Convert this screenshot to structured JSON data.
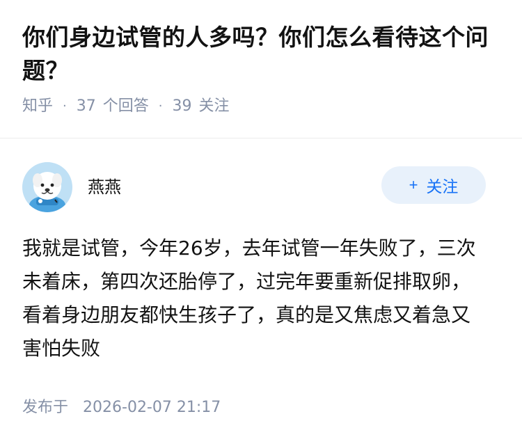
{
  "question": {
    "title": "你们身边试管的人多吗？你们怎么看待这个问题？",
    "source": "知乎",
    "answer_count": "37",
    "answer_label": "个回答",
    "follow_count": "39",
    "follow_label": "关注"
  },
  "answer": {
    "author_name": "燕燕",
    "follow_button": "关注",
    "content": "我就是试管，今年26岁，去年试管一年失败了，三次未着床，第四次还胎停了，过完年要重新促排取卵，看着身边朋友都快生孩子了，真的是又焦虑又着急又害怕失败",
    "published_label": "发布于",
    "published_time": "2026-02-07 21:17"
  },
  "colors": {
    "accent": "#1772f6",
    "follow_bg": "#e8f1fb",
    "meta": "#8590a6"
  },
  "icons": {
    "avatar": "cartoon-dog-avatar",
    "plus": "plus-icon"
  }
}
